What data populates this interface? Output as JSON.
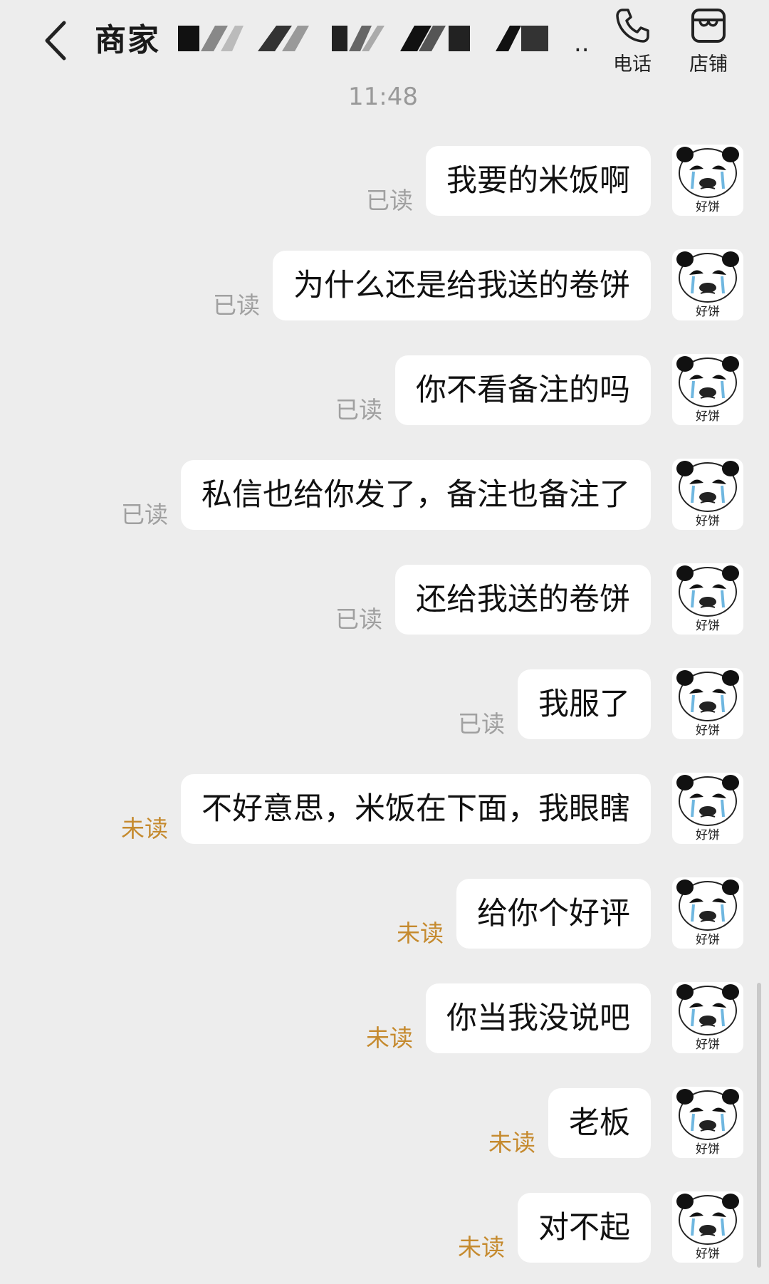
{
  "header": {
    "title": "商家",
    "title_trailing": "..",
    "phone_label": "电话",
    "store_label": "店铺"
  },
  "timestamp": "11:48",
  "avatar_caption": "好饼",
  "colors": {
    "background": "#ededed",
    "bubble": "#ffffff",
    "read": "#a0a0a0",
    "unread": "#c58a2e"
  },
  "messages": [
    {
      "text": "我要的米饭啊",
      "status": "已读",
      "state": "read"
    },
    {
      "text": "为什么还是给我送的卷饼",
      "status": "已读",
      "state": "read"
    },
    {
      "text": "你不看备注的吗",
      "status": "已读",
      "state": "read"
    },
    {
      "text": "私信也给你发了，备注也备注了",
      "status": "已读",
      "state": "read"
    },
    {
      "text": "还给我送的卷饼",
      "status": "已读",
      "state": "read"
    },
    {
      "text": "我服了",
      "status": "已读",
      "state": "read"
    },
    {
      "text": "不好意思，米饭在下面，我眼瞎",
      "status": "未读",
      "state": "unread"
    },
    {
      "text": "给你个好评",
      "status": "未读",
      "state": "unread"
    },
    {
      "text": "你当我没说吧",
      "status": "未读",
      "state": "unread"
    },
    {
      "text": "老板",
      "status": "未读",
      "state": "unread"
    },
    {
      "text": "对不起",
      "status": "未读",
      "state": "unread"
    }
  ]
}
